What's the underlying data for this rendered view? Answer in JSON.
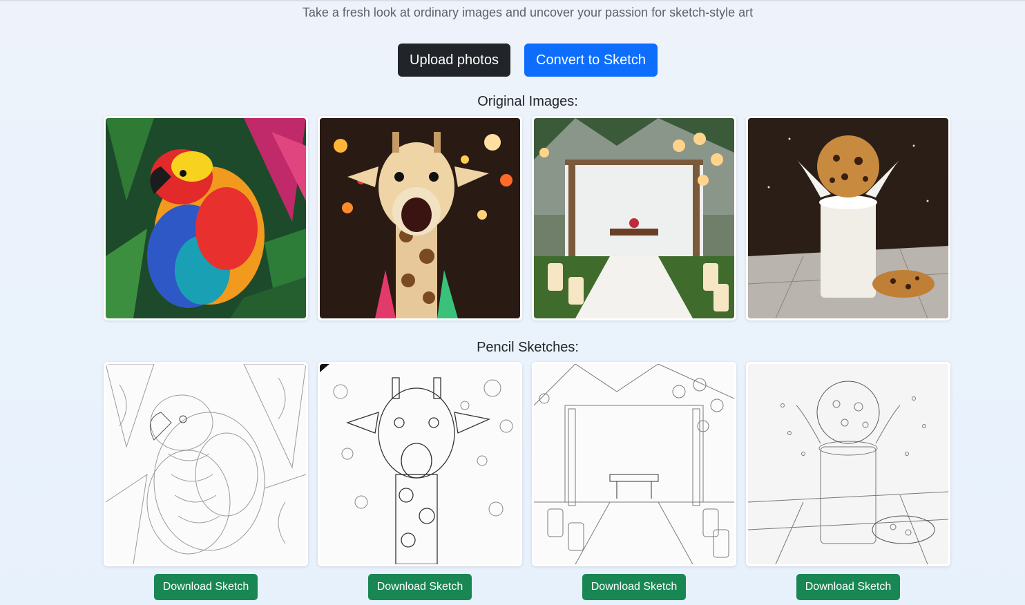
{
  "header": {
    "tagline": "Take a fresh look at ordinary images and uncover your passion for sketch-style art"
  },
  "actions": {
    "upload_label": "Upload photos",
    "convert_label": "Convert to Sketch"
  },
  "originals": {
    "title": "Original Images:"
  },
  "sketches": {
    "title": "Pencil Sketches:",
    "download_labels": [
      "Download Sketch",
      "Download Sketch",
      "Download Sketch",
      "Download Sketch"
    ]
  },
  "colors": {
    "primary": "#0d6efd",
    "dark": "#212529",
    "success": "#198754"
  }
}
